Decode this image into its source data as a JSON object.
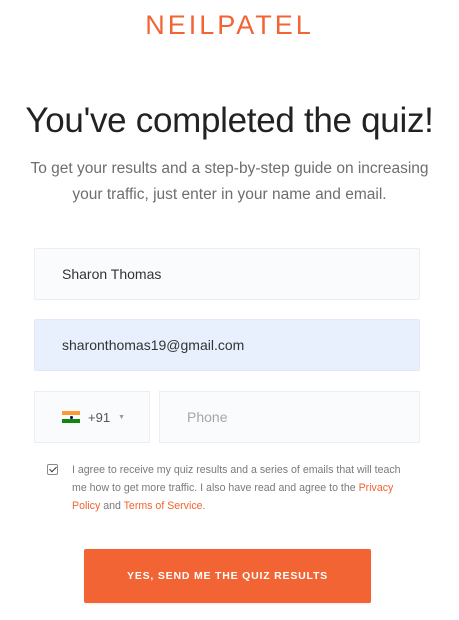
{
  "brand": {
    "logo_text": "NEILPATEL",
    "accent_color": "#f26433"
  },
  "headline": "You've completed the quiz!",
  "subtext": "To get your results and a step-by-step guide on increasing your traffic, just enter in your name and email.",
  "form": {
    "name_value": "Sharon Thomas",
    "email_value": "sharonthomas19@gmail.com",
    "country_flag": "india-flag-icon",
    "country_code": "+91",
    "phone_placeholder": "Phone",
    "consent_checked": true,
    "consent_text_1": "I agree to receive my quiz results and a series of emails that will teach me how to get more traffic. I also have read and agree to the ",
    "privacy_link": "Privacy Policy",
    "consent_and": " and ",
    "terms_link": "Terms of Service",
    "consent_end": ".",
    "submit_label": "YES, SEND ME THE QUIZ RESULTS"
  }
}
